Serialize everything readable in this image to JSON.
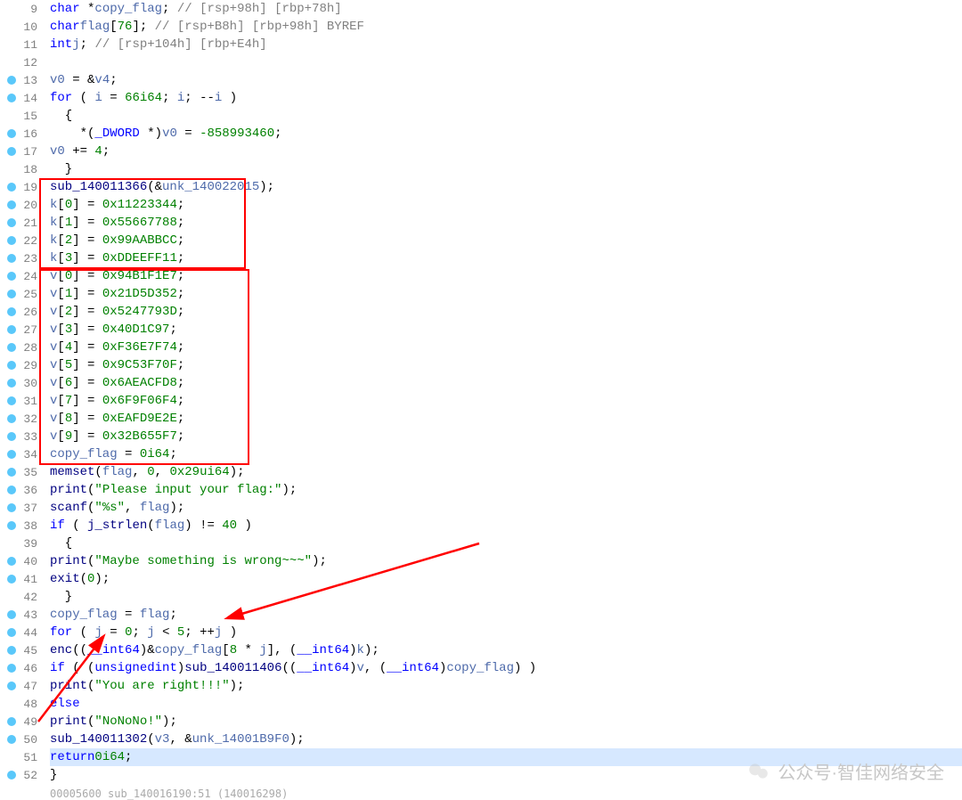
{
  "lines": [
    {
      "n": 9,
      "bp": false,
      "html": "  <span class='ty'>char</span> *<span class='var'>copy_flag</span>; <span class='cmt'>// [rsp+98h] [rbp+78h]</span>"
    },
    {
      "n": 10,
      "bp": false,
      "html": "  <span class='ty'>char</span> <span class='var'>flag</span>[<span class='num'>76</span>]; <span class='cmt'>// [rsp+B8h] [rbp+98h] BYREF</span>"
    },
    {
      "n": 11,
      "bp": false,
      "html": "  <span class='ty'>int</span> <span class='var'>j</span>; <span class='cmt'>// [rsp+104h] [rbp+E4h]</span>"
    },
    {
      "n": 12,
      "bp": false,
      "html": ""
    },
    {
      "n": 13,
      "bp": true,
      "html": "  <span class='var'>v0</span> = &amp;<span class='var'>v4</span>;"
    },
    {
      "n": 14,
      "bp": true,
      "html": "  <span class='kw'>for</span> ( <span class='var'>i</span> = <span class='num'>66i64</span>; <span class='var'>i</span>; --<span class='var'>i</span> )"
    },
    {
      "n": 15,
      "bp": false,
      "html": "  {"
    },
    {
      "n": 16,
      "bp": true,
      "html": "    *(<span class='ty'>_DWORD</span> *)<span class='var'>v0</span> = <span class='num'>-858993460</span>;"
    },
    {
      "n": 17,
      "bp": true,
      "html": "    <span class='var'>v0</span> += <span class='num'>4</span>;"
    },
    {
      "n": 18,
      "bp": false,
      "html": "  }"
    },
    {
      "n": 19,
      "bp": true,
      "html": "  <span class='fn'>sub_140011366</span>(&amp;<span class='var'>unk_140022015</span>);"
    },
    {
      "n": 20,
      "bp": true,
      "html": "  <span class='var'>k</span>[<span class='num'>0</span>] = <span class='hex'>0x11223344</span>;"
    },
    {
      "n": 21,
      "bp": true,
      "html": "  <span class='var'>k</span>[<span class='num'>1</span>] = <span class='hex'>0x55667788</span>;"
    },
    {
      "n": 22,
      "bp": true,
      "html": "  <span class='var'>k</span>[<span class='num'>2</span>] = <span class='hex'>0x99AABBCC</span>;"
    },
    {
      "n": 23,
      "bp": true,
      "html": "  <span class='var'>k</span>[<span class='num'>3</span>] = <span class='hex'>0xDDEEFF11</span>;"
    },
    {
      "n": 24,
      "bp": true,
      "html": "  <span class='var'>v</span>[<span class='num'>0</span>] = <span class='hex'>0x94B1F1E7</span>;"
    },
    {
      "n": 25,
      "bp": true,
      "html": "  <span class='var'>v</span>[<span class='num'>1</span>] = <span class='hex'>0x21D5D352</span>;"
    },
    {
      "n": 26,
      "bp": true,
      "html": "  <span class='var'>v</span>[<span class='num'>2</span>] = <span class='hex'>0x5247793D</span>;"
    },
    {
      "n": 27,
      "bp": true,
      "html": "  <span class='var'>v</span>[<span class='num'>3</span>] = <span class='hex'>0x40D1C97</span>;"
    },
    {
      "n": 28,
      "bp": true,
      "html": "  <span class='var'>v</span>[<span class='num'>4</span>] = <span class='hex'>0xF36E7F74</span>;"
    },
    {
      "n": 29,
      "bp": true,
      "html": "  <span class='var'>v</span>[<span class='num'>5</span>] = <span class='hex'>0x9C53F70F</span>;"
    },
    {
      "n": 30,
      "bp": true,
      "html": "  <span class='var'>v</span>[<span class='num'>6</span>] = <span class='hex'>0x6AEACFD8</span>;"
    },
    {
      "n": 31,
      "bp": true,
      "html": "  <span class='var'>v</span>[<span class='num'>7</span>] = <span class='hex'>0x6F9F06F4</span>;"
    },
    {
      "n": 32,
      "bp": true,
      "html": "  <span class='var'>v</span>[<span class='num'>8</span>] = <span class='hex'>0xEAFD9E2E</span>;"
    },
    {
      "n": 33,
      "bp": true,
      "html": "  <span class='var'>v</span>[<span class='num'>9</span>] = <span class='hex'>0x32B655F7</span>;"
    },
    {
      "n": 34,
      "bp": true,
      "html": "  <span class='var'>copy_flag</span> = <span class='num'>0i64</span>;"
    },
    {
      "n": 35,
      "bp": true,
      "html": "  <span class='fn'>memset</span>(<span class='var'>flag</span>, <span class='num'>0</span>, <span class='hex'>0x29ui64</span>);"
    },
    {
      "n": 36,
      "bp": true,
      "html": "  <span class='fn'>print</span>(<span class='str'>\"Please input your flag:\"</span>);"
    },
    {
      "n": 37,
      "bp": true,
      "html": "  <span class='fn'>scanf</span>(<span class='str'>\"%s\"</span>, <span class='var'>flag</span>);"
    },
    {
      "n": 38,
      "bp": true,
      "html": "  <span class='kw'>if</span> ( <span class='fn'>j_strlen</span>(<span class='var'>flag</span>) != <span class='num'>40</span> )"
    },
    {
      "n": 39,
      "bp": false,
      "html": "  {"
    },
    {
      "n": 40,
      "bp": true,
      "html": "    <span class='fn'>print</span>(<span class='str'>\"Maybe something is wrong~~~\"</span>);"
    },
    {
      "n": 41,
      "bp": true,
      "html": "    <span class='fn'>exit</span>(<span class='num'>0</span>);"
    },
    {
      "n": 42,
      "bp": false,
      "html": "  }"
    },
    {
      "n": 43,
      "bp": true,
      "html": "  <span class='var'>copy_flag</span> = <span class='var'>flag</span>;"
    },
    {
      "n": 44,
      "bp": true,
      "html": "  <span class='kw'>for</span> ( <span class='var'>j</span> = <span class='num'>0</span>; <span class='var'>j</span> &lt; <span class='num'>5</span>; ++<span class='var'>j</span> )"
    },
    {
      "n": 45,
      "bp": true,
      "html": "    <span class='fn'>enc</span>((<span class='ty'>__int64</span>)&amp;<span class='var'>copy_flag</span>[<span class='num'>8</span> * <span class='var'>j</span>], (<span class='ty'>__int64</span>)<span class='var'>k</span>);"
    },
    {
      "n": 46,
      "bp": true,
      "html": "  <span class='kw'>if</span> ( (<span class='ty'>unsigned</span> <span class='ty'>int</span>)<span class='fn'>sub_140011406</span>((<span class='ty'>__int64</span>)<span class='var'>v</span>, (<span class='ty'>__int64</span>)<span class='var'>copy_flag</span>) )"
    },
    {
      "n": 47,
      "bp": true,
      "html": "    <span class='fn'>print</span>(<span class='str'>\"You are right!!!\"</span>);"
    },
    {
      "n": 48,
      "bp": false,
      "html": "  <span class='kw'>else</span>"
    },
    {
      "n": 49,
      "bp": true,
      "html": "    <span class='fn'>print</span>(<span class='str'>\"NoNoNo!\"</span>);"
    },
    {
      "n": 50,
      "bp": true,
      "html": "  <span class='fn'>sub_140011302</span>(<span class='var'>v3</span>, &amp;<span class='var'>unk_14001B9F0</span>);"
    },
    {
      "n": 51,
      "bp": false,
      "hl": true,
      "html": "  <span class='kw'>return</span> <span class='num'>0i64</span>;"
    },
    {
      "n": 52,
      "bp": true,
      "html": "}"
    }
  ],
  "footer": "00005600 sub_140016190:51 (140016298)",
  "watermark": "公众号·智佳网络安全"
}
